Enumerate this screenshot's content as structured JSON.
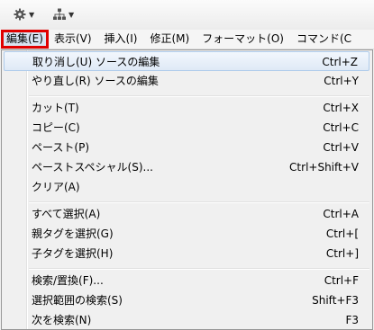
{
  "toolbar": {
    "icons": [
      "gear-icon",
      "hierarchy-icon"
    ]
  },
  "menubar": {
    "items": [
      {
        "label": "編集(E)"
      },
      {
        "label": "表示(V)"
      },
      {
        "label": "挿入(I)"
      },
      {
        "label": "修正(M)"
      },
      {
        "label": "フォーマット(O)"
      },
      {
        "label": "コマンド(C"
      }
    ]
  },
  "edit_menu": {
    "items": [
      {
        "label": "取り消し(U) ソースの編集",
        "shortcut": "Ctrl+Z"
      },
      {
        "label": "やり直し(R) ソースの編集",
        "shortcut": "Ctrl+Y"
      },
      {
        "label": "カット(T)",
        "shortcut": "Ctrl+X"
      },
      {
        "label": "コピー(C)",
        "shortcut": "Ctrl+C"
      },
      {
        "label": "ペースト(P)",
        "shortcut": "Ctrl+V"
      },
      {
        "label": "ペーストスペシャル(S)...",
        "shortcut": "Ctrl+Shift+V"
      },
      {
        "label": "クリア(A)",
        "shortcut": ""
      },
      {
        "label": "すべて選択(A)",
        "shortcut": "Ctrl+A"
      },
      {
        "label": "親タグを選択(G)",
        "shortcut": "Ctrl+["
      },
      {
        "label": "子タグを選択(H)",
        "shortcut": "Ctrl+]"
      },
      {
        "label": "検索/置換(F)...",
        "shortcut": "Ctrl+F"
      },
      {
        "label": "選択範囲の検索(S)",
        "shortcut": "Shift+F3"
      },
      {
        "label": "次を検索(N)",
        "shortcut": "F3"
      }
    ]
  }
}
